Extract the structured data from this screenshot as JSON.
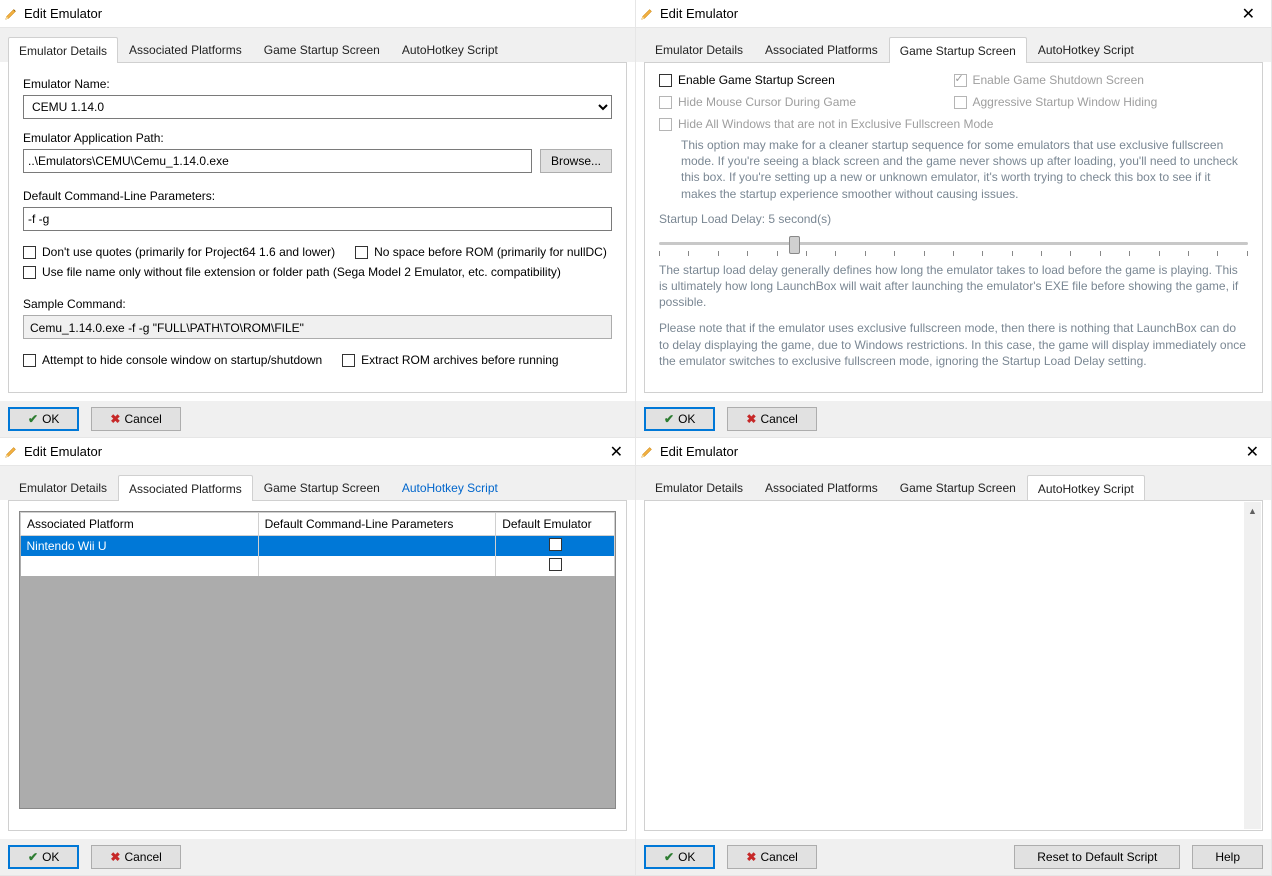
{
  "common": {
    "window_title": "Edit Emulator",
    "ok": "OK",
    "cancel": "Cancel",
    "browse": "Browse...",
    "tabs": {
      "details": "Emulator Details",
      "platforms": "Associated Platforms",
      "startup": "Game Startup Screen",
      "ahk": "AutoHotkey Script"
    }
  },
  "details": {
    "name_label": "Emulator Name:",
    "name_value": "CEMU 1.14.0",
    "path_label": "Emulator Application Path:",
    "path_value": "..\\Emulators\\CEMU\\Cemu_1.14.0.exe",
    "params_label": "Default Command-Line Parameters:",
    "params_value": "-f -g",
    "chk_noquotes": "Don't use quotes (primarily for Project64 1.6 and lower)",
    "chk_nospace": "No space before ROM (primarily for nullDC)",
    "chk_filenameonly": "Use file name only without file extension or folder path (Sega Model 2 Emulator, etc. compatibility)",
    "sample_label": "Sample Command:",
    "sample_value": "Cemu_1.14.0.exe -f -g \"FULL\\PATH\\TO\\ROM\\FILE\"",
    "chk_hideconsole": "Attempt to hide console window on startup/shutdown",
    "chk_extract": "Extract ROM archives before running"
  },
  "platforms": {
    "col_platform": "Associated Platform",
    "col_params": "Default Command-Line Parameters",
    "col_default": "Default Emulator",
    "rows": [
      {
        "platform": "Nintendo Wii U",
        "params": "",
        "default_checked": false
      }
    ]
  },
  "startup": {
    "chk_enable": "Enable Game Startup Screen",
    "chk_shutdown": "Enable Game Shutdown Screen",
    "chk_hidemouse": "Hide Mouse Cursor During Game",
    "chk_aggressive": "Aggressive Startup Window Hiding",
    "chk_hideall": "Hide All Windows that are not in Exclusive Fullscreen Mode",
    "hideall_help": "This option may make for a cleaner startup sequence for some emulators that use exclusive fullscreen mode. If you're seeing a black screen and the game never shows up after loading, you'll need to uncheck this box. If you're setting up a new or unknown emulator, it's worth trying to check this box to see if it makes the startup experience smoother without causing issues.",
    "delay_label": "Startup Load Delay: 5 second(s)",
    "delay_help1": "The startup load delay generally defines how long the emulator takes to load before the game is playing. This is ultimately how long LaunchBox will wait after launching the emulator's EXE file before showing the game, if possible.",
    "delay_help2": "Please note that if the emulator uses exclusive fullscreen mode, then there is nothing that LaunchBox can do to delay displaying the game, due to Windows restrictions. In this case, the game will display immediately once the emulator switches to exclusive fullscreen mode, ignoring the Startup Load Delay setting."
  },
  "ahk": {
    "reset": "Reset to Default Script",
    "help": "Help"
  }
}
